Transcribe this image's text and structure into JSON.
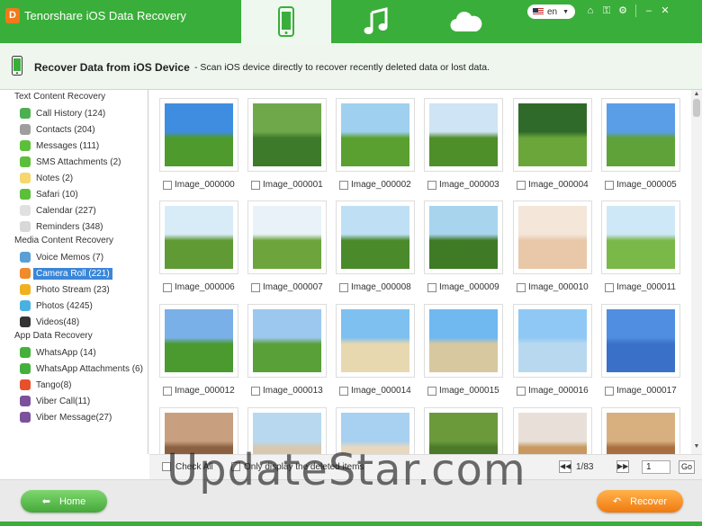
{
  "window": {
    "title": "Tenorshare iOS Data Recovery",
    "logo_letter": "D",
    "language": "en",
    "modes": [
      {
        "name": "device-mode-icon",
        "active": true
      },
      {
        "name": "itunes-mode-icon",
        "active": false
      },
      {
        "name": "icloud-mode-icon",
        "active": false
      }
    ],
    "controls": [
      "home-icon",
      "key-icon",
      "settings-icon",
      "minimize-icon",
      "close-icon"
    ]
  },
  "header": {
    "title": "Recover Data from iOS Device",
    "description": "- Scan iOS device directly to recover recently deleted data or lost data."
  },
  "sidebar": {
    "sections": [
      {
        "label": "Text Content Recovery",
        "items": [
          {
            "label": "Call History (124)",
            "icon": "phone-icon",
            "color": "#4caf50"
          },
          {
            "label": "Contacts (204)",
            "icon": "contacts-icon",
            "color": "#9e9e9e"
          },
          {
            "label": "Messages (111)",
            "icon": "messages-icon",
            "color": "#5cbf3a"
          },
          {
            "label": "SMS Attachments (2)",
            "icon": "sms-attachment-icon",
            "color": "#5cbf3a"
          },
          {
            "label": "Notes (2)",
            "icon": "notes-icon",
            "color": "#f5d76e"
          },
          {
            "label": "Safari (10)",
            "icon": "safari-icon",
            "color": "#5cbf3a"
          },
          {
            "label": "Calendar (227)",
            "icon": "calendar-icon",
            "color": "#e0e0e0"
          },
          {
            "label": "Reminders (348)",
            "icon": "reminders-icon",
            "color": "#d8d8d8"
          }
        ]
      },
      {
        "label": "Media Content Recovery",
        "items": [
          {
            "label": "Voice Memos (7)",
            "icon": "microphone-icon",
            "color": "#5a9fd6"
          },
          {
            "label": "Camera Roll (221)",
            "icon": "camera-roll-icon",
            "color": "#f08a2a",
            "selected": true
          },
          {
            "label": "Photo Stream (23)",
            "icon": "photo-stream-icon",
            "color": "#f0b020"
          },
          {
            "label": "Photos (4245)",
            "icon": "photos-icon",
            "color": "#4ab0e0"
          },
          {
            "label": "Videos(48)",
            "icon": "videos-icon",
            "color": "#333333"
          }
        ]
      },
      {
        "label": "App Data Recovery",
        "items": [
          {
            "label": "WhatsApp (14)",
            "icon": "whatsapp-icon",
            "color": "#43b03c"
          },
          {
            "label": "WhatsApp Attachments (6)",
            "icon": "whatsapp-attachment-icon",
            "color": "#43b03c"
          },
          {
            "label": "Tango(8)",
            "icon": "tango-icon",
            "color": "#e8502a"
          },
          {
            "label": "Viber Call(11)",
            "icon": "viber-call-icon",
            "color": "#7b519d"
          },
          {
            "label": "Viber Message(27)",
            "icon": "viber-message-icon",
            "color": "#7b519d"
          }
        ]
      }
    ]
  },
  "photos": [
    {
      "name": "Image_000000",
      "sky": "#3f8de0",
      "ground": "#4e9a2c"
    },
    {
      "name": "Image_000001",
      "sky": "#6fa84a",
      "ground": "#3d7a2a"
    },
    {
      "name": "Image_000002",
      "sky": "#9fd0f0",
      "ground": "#5aa030"
    },
    {
      "name": "Image_000003",
      "sky": "#cfe4f4",
      "ground": "#4f8f2a"
    },
    {
      "name": "Image_000004",
      "sky": "#2f6a2a",
      "ground": "#6aa63a"
    },
    {
      "name": "Image_000005",
      "sky": "#5a9ee8",
      "ground": "#5fa23a"
    },
    {
      "name": "Image_000006",
      "sky": "#d8ecf8",
      "ground": "#5f9a35"
    },
    {
      "name": "Image_000007",
      "sky": "#e8f2f8",
      "ground": "#6ea43c"
    },
    {
      "name": "Image_000008",
      "sky": "#bfe0f4",
      "ground": "#4a8a2a"
    },
    {
      "name": "Image_000009",
      "sky": "#a8d4ee",
      "ground": "#3f7a25"
    },
    {
      "name": "Image_000010",
      "sky": "#f4e6d8",
      "ground": "#e8c8a8"
    },
    {
      "name": "Image_000011",
      "sky": "#cfe8f8",
      "ground": "#7ab84a"
    },
    {
      "name": "Image_000012",
      "sky": "#7ab0e8",
      "ground": "#4a9a30"
    },
    {
      "name": "Image_000013",
      "sky": "#9cc8f0",
      "ground": "#5aa038"
    },
    {
      "name": "Image_000014",
      "sky": "#7ec0f0",
      "ground": "#e8d8b0"
    },
    {
      "name": "Image_000015",
      "sky": "#6fb8f0",
      "ground": "#d8c8a0"
    },
    {
      "name": "Image_000016",
      "sky": "#8fc8f4",
      "ground": "#b8d8f0"
    },
    {
      "name": "Image_000017",
      "sky": "#4f8ee0",
      "ground": "#3a70c8"
    },
    {
      "name": "",
      "sky": "#c8a080",
      "ground": "#8a6040"
    },
    {
      "name": "",
      "sky": "#b8d8f0",
      "ground": "#d8c8b0"
    },
    {
      "name": "",
      "sky": "#a8d0f0",
      "ground": "#e8d8c0"
    },
    {
      "name": "",
      "sky": "#6a9a3a",
      "ground": "#4a7a2a"
    },
    {
      "name": "",
      "sky": "#e8e0d8",
      "ground": "#c89860"
    },
    {
      "name": "",
      "sky": "#d8b080",
      "ground": "#a87040"
    }
  ],
  "bottom_bar": {
    "check_all": "Check All",
    "only_deleted": "Only display the deleted items",
    "page_info": "1/83",
    "page_input": "1",
    "go": "Go"
  },
  "footer": {
    "home": "Home",
    "recover": "Recover"
  },
  "watermark": "UpdateStar.com"
}
